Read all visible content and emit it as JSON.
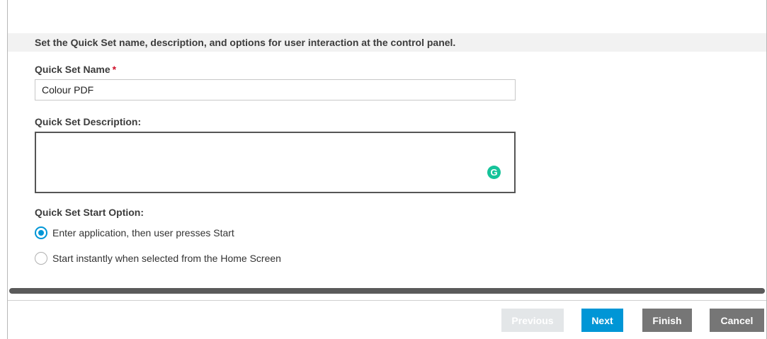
{
  "form": {
    "instruction": "Set the Quick Set name, description, and options for user interaction at the control panel.",
    "name_label": "Quick Set Name",
    "required_marker": "*",
    "name_value": "Colour PDF",
    "description_label": "Quick Set Description:",
    "description_value": "",
    "grammarly_icon": "G",
    "start_option_label": "Quick Set Start Option:",
    "start_options": [
      {
        "label": "Enter application, then user presses Start",
        "selected": true
      },
      {
        "label": "Start instantly when selected from the Home Screen",
        "selected": false
      }
    ]
  },
  "footer": {
    "previous_label": "Previous",
    "previous_enabled": false,
    "next_label": "Next",
    "finish_label": "Finish",
    "cancel_label": "Cancel"
  },
  "colors": {
    "accent": "#0096d6",
    "required": "#d0112b",
    "secondary_button": "#767676",
    "disabled_button": "#e3e6e8",
    "grammarly": "#15c39a"
  }
}
